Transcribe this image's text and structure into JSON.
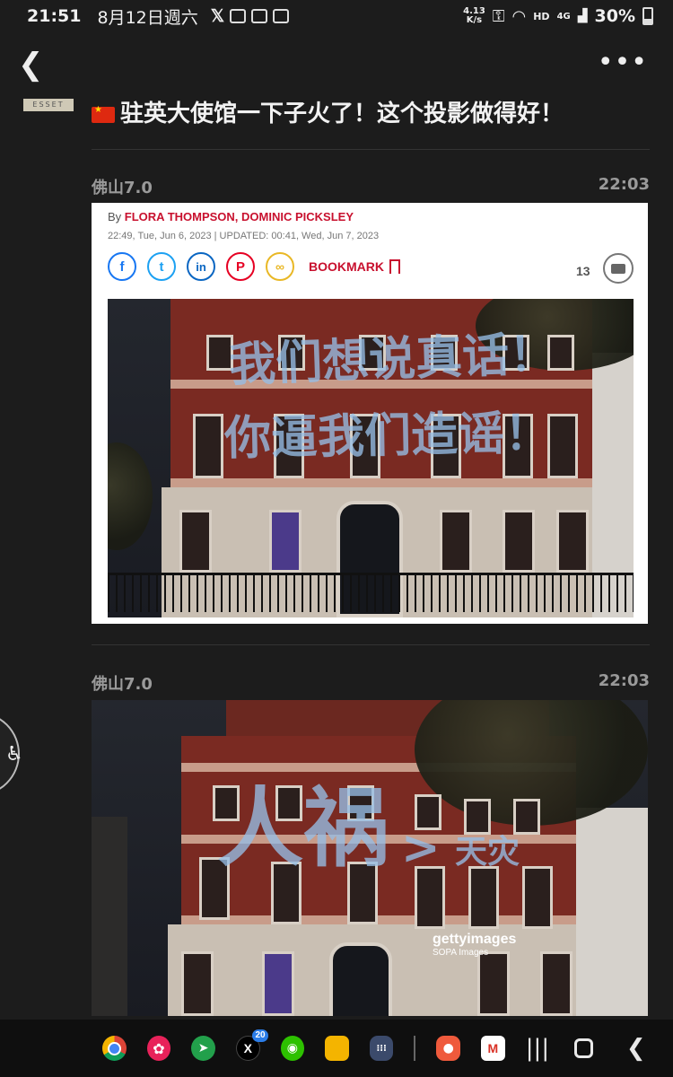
{
  "status_bar": {
    "time": "21:51",
    "date": "8月12日週六",
    "net_speed_value": "4.13",
    "net_speed_unit": "K/s",
    "hd_label": "HD",
    "signal_label": "4G",
    "battery": "30%"
  },
  "post": {
    "title": "驻英大使馆一下子火了！这个投影做得好！",
    "avatar_text": "ESSET"
  },
  "messages": [
    {
      "sender": "佛山7.0",
      "time": "22:03",
      "article": {
        "by_prefix": "By ",
        "authors": "FLORA THOMPSON, DOMINIC PICKSLEY",
        "meta": "22:49, Tue, Jun 6, 2023 | UPDATED: 00:41, Wed, Jun 7, 2023",
        "bookmark_label": "BOOKMARK",
        "comment_count": "13"
      },
      "projection_line1": "我们想说真话！",
      "projection_line2": "你逼我们造谣！"
    },
    {
      "sender": "佛山7.0",
      "time": "22:03",
      "projection_big": "人祸",
      "projection_arrow": ">",
      "projection_small": "天灾",
      "watermark": "gettyimages",
      "watermark_credit": "SOPA Images"
    }
  ],
  "dock": {
    "x_badge": "20",
    "apps": [
      "chrome-icon",
      "blossom-icon",
      "compass-icon",
      "x-icon",
      "wechat-icon",
      "folder-icon",
      "app-grid-icon",
      "contacts-icon",
      "gmail-icon"
    ]
  },
  "colors": {
    "background": "#1c1c1c",
    "author_red": "#c8102e",
    "facade_brick": "#7a2a22",
    "projection_blue": "#96bee6"
  }
}
